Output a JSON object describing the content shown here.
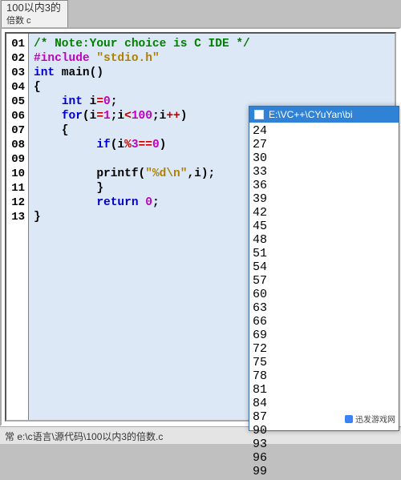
{
  "tab": {
    "line1": "100以内3的",
    "line2": "倍数 c"
  },
  "gutter": [
    "01",
    "02",
    "03",
    "04",
    "05",
    "06",
    "07",
    "08",
    "09",
    "10",
    "11",
    "12",
    "13"
  ],
  "code": [
    [
      {
        "k": "c-comment",
        "t": "/* Note:Your choice is C IDE */"
      }
    ],
    [
      {
        "k": "c-pre",
        "t": "#include "
      },
      {
        "k": "c-str",
        "t": "\"stdio.h\""
      }
    ],
    [
      {
        "k": "c-key",
        "t": "int"
      },
      {
        "k": "",
        "t": " main()"
      }
    ],
    [
      {
        "k": "",
        "t": "{"
      }
    ],
    [
      {
        "k": "",
        "t": "    "
      },
      {
        "k": "c-key",
        "t": "int"
      },
      {
        "k": "",
        "t": " i"
      },
      {
        "k": "c-op",
        "t": "="
      },
      {
        "k": "c-num",
        "t": "0"
      },
      {
        "k": "",
        "t": ";"
      }
    ],
    [
      {
        "k": "",
        "t": "    "
      },
      {
        "k": "c-key",
        "t": "for"
      },
      {
        "k": "",
        "t": "(i"
      },
      {
        "k": "c-op",
        "t": "="
      },
      {
        "k": "c-num",
        "t": "1"
      },
      {
        "k": "",
        "t": ";i"
      },
      {
        "k": "c-op",
        "t": "<"
      },
      {
        "k": "c-num",
        "t": "100"
      },
      {
        "k": "",
        "t": ";i"
      },
      {
        "k": "c-op",
        "t": "++"
      },
      {
        "k": "",
        "t": ")"
      }
    ],
    [
      {
        "k": "",
        "t": "    {"
      }
    ],
    [
      {
        "k": "",
        "t": "         "
      },
      {
        "k": "c-key",
        "t": "if"
      },
      {
        "k": "",
        "t": "(i"
      },
      {
        "k": "c-op",
        "t": "%"
      },
      {
        "k": "c-num",
        "t": "3"
      },
      {
        "k": "c-op",
        "t": "=="
      },
      {
        "k": "c-num",
        "t": "0"
      },
      {
        "k": "",
        "t": ")"
      }
    ],
    [
      {
        "k": "",
        "t": ""
      }
    ],
    [
      {
        "k": "",
        "t": "         printf("
      },
      {
        "k": "c-str",
        "t": "\"%d\\n\""
      },
      {
        "k": "",
        "t": ",i);"
      }
    ],
    [
      {
        "k": "",
        "t": "         }"
      }
    ],
    [
      {
        "k": "",
        "t": "         "
      },
      {
        "k": "c-key",
        "t": "return"
      },
      {
        "k": "",
        "t": " "
      },
      {
        "k": "c-num",
        "t": "0"
      },
      {
        "k": "",
        "t": ";"
      }
    ],
    [
      {
        "k": "",
        "t": "}"
      }
    ]
  ],
  "output": {
    "title": "E:\\VC++\\CYuYan\\bi",
    "lines": [
      "24",
      "27",
      "30",
      "33",
      "36",
      "39",
      "42",
      "45",
      "48",
      "51",
      "54",
      "57",
      "60",
      "63",
      "66",
      "69",
      "72",
      "75",
      "78",
      "81",
      "84",
      "87",
      "90",
      "93",
      "96",
      "99"
    ]
  },
  "status": "常 e:\\c语言\\源代码\\100以内3的倍数.c",
  "watermark": "迅发游戏网"
}
